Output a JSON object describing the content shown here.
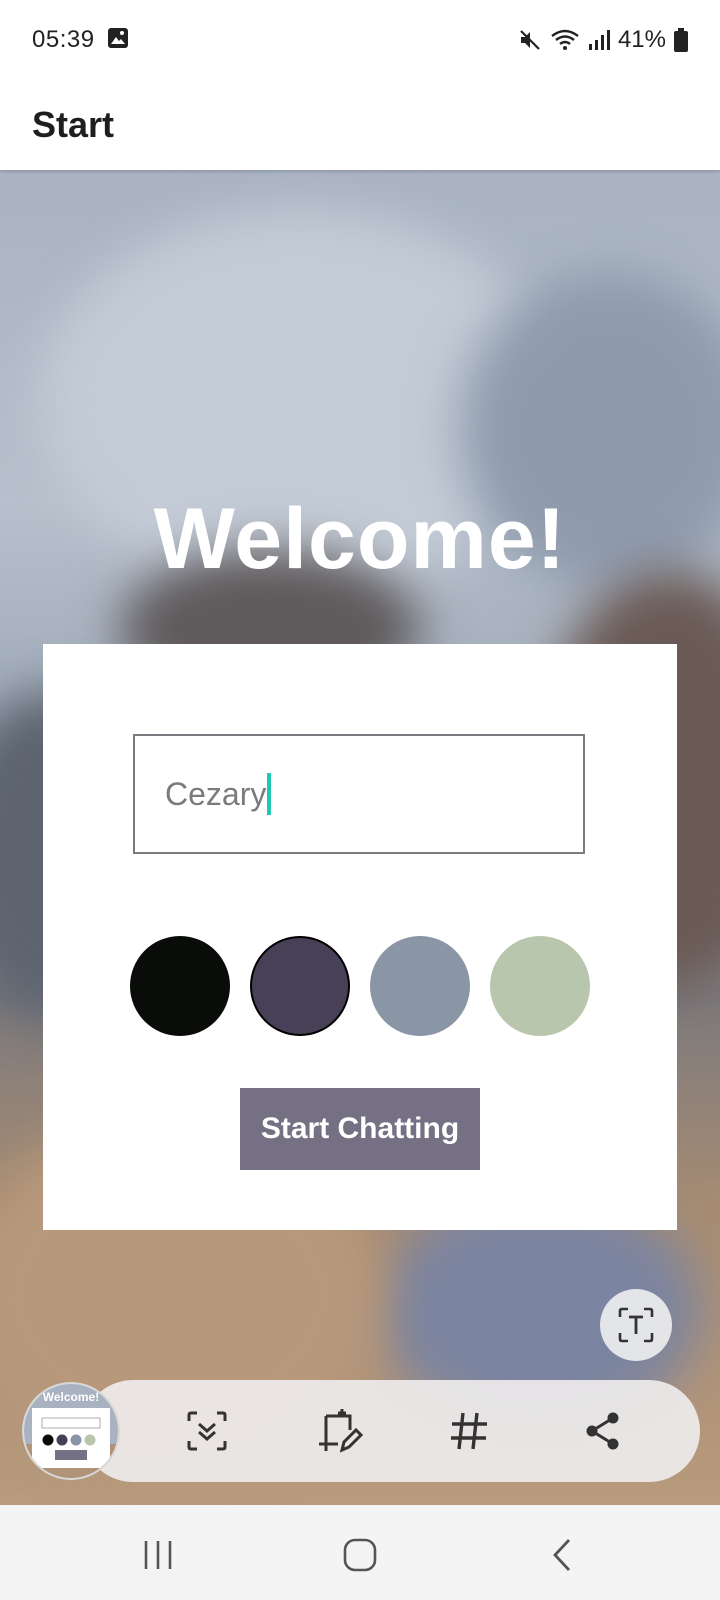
{
  "status_bar": {
    "time": "05:39",
    "battery": "41%",
    "icons": [
      "image-icon",
      "mute-icon",
      "wifi-icon",
      "signal-icon",
      "battery-icon"
    ]
  },
  "app_bar": {
    "title": "Start"
  },
  "main": {
    "heading": "Welcome!",
    "name_input": {
      "value": "Cezary",
      "placeholder": ""
    },
    "colors": [
      {
        "name": "black",
        "hex": "#090C08"
      },
      {
        "name": "purple",
        "hex": "#474056",
        "selected": true
      },
      {
        "name": "grey-blue",
        "hex": "#8A95A5"
      },
      {
        "name": "green",
        "hex": "#B9C6AE"
      }
    ],
    "start_button": {
      "label": "Start Chatting",
      "color": "#757083"
    }
  },
  "screenshot_toolbar": {
    "thumbnail_title": "Welcome!",
    "tools": [
      "scroll-capture-icon",
      "edit-crop-icon",
      "hashtag-icon",
      "share-icon"
    ]
  },
  "extract_text_icon": "text-extract-icon",
  "nav_bar": {
    "buttons": [
      "recent-apps-icon",
      "home-icon",
      "back-icon"
    ]
  }
}
